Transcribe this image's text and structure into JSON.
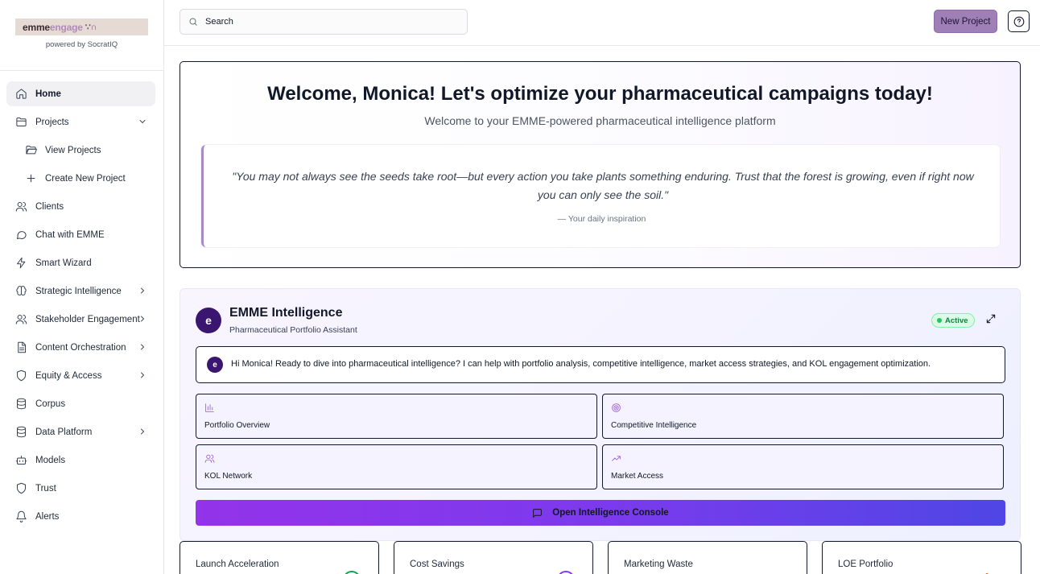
{
  "brand": {
    "logo_part1": "emme",
    "logo_part2": "engage",
    "logo_mark": "∵ɴʌ",
    "powered_by": "powered by SocratIQ"
  },
  "sidebar": {
    "items": [
      {
        "label": "Home",
        "icon": "home-icon"
      },
      {
        "label": "Projects",
        "icon": "folder-icon"
      },
      {
        "label": "View Projects",
        "icon": "folder-open-icon"
      },
      {
        "label": "Create New Project",
        "icon": "plus-icon"
      },
      {
        "label": "Clients",
        "icon": "users-icon"
      },
      {
        "label": "Chat with EMME",
        "icon": "chat-icon"
      },
      {
        "label": "Smart Wizard",
        "icon": "zap-icon"
      },
      {
        "label": "Strategic Intelligence",
        "icon": "brain-icon"
      },
      {
        "label": "Stakeholder Engagement",
        "icon": "users-icon"
      },
      {
        "label": "Content Orchestration",
        "icon": "document-icon"
      },
      {
        "label": "Equity & Access",
        "icon": "shield-icon"
      },
      {
        "label": "Corpus",
        "icon": "database-icon"
      },
      {
        "label": "Data Platform",
        "icon": "database-icon"
      },
      {
        "label": "Models",
        "icon": "bot-icon"
      },
      {
        "label": "Trust",
        "icon": "shield-icon"
      },
      {
        "label": "Alerts",
        "icon": "bell-icon"
      }
    ]
  },
  "topbar": {
    "search_placeholder": "Search",
    "new_project_label": "New Project"
  },
  "welcome": {
    "title": "Welcome, Monica! Let's optimize your pharmaceutical campaigns today!",
    "subtitle": "Welcome to your EMME-powered pharmaceutical intelligence platform",
    "quote": "\"You may not always see the seeds take root—but every action you take plants something enduring. Trust that the forest is growing, even if right now you can only see the soil.\"",
    "attribution": "— Your daily inspiration"
  },
  "intelligence": {
    "avatar_letter": "e",
    "title": "EMME Intelligence",
    "subtitle": "Pharmaceutical Portfolio Assistant",
    "status": "Active",
    "message": "Hi Monica! Ready to dive into pharmaceutical intelligence? I can help with portfolio analysis, competitive intelligence, market access strategies, and KOL engagement optimization.",
    "tiles": [
      {
        "label": "Portfolio Overview",
        "icon": "bar-chart-icon"
      },
      {
        "label": "Competitive Intelligence",
        "icon": "target-icon"
      },
      {
        "label": "KOL Network",
        "icon": "users-icon"
      },
      {
        "label": "Market Access",
        "icon": "trending-up-icon"
      }
    ],
    "console_label": "Open Intelligence Console"
  },
  "metrics": [
    {
      "label": "Launch Acceleration",
      "color": "#16a34a"
    },
    {
      "label": "Cost Savings",
      "color": "#9333ea"
    },
    {
      "label": "Marketing Waste",
      "color": "#111827"
    },
    {
      "label": "LOE Portfolio",
      "color": "#ea580c"
    }
  ]
}
